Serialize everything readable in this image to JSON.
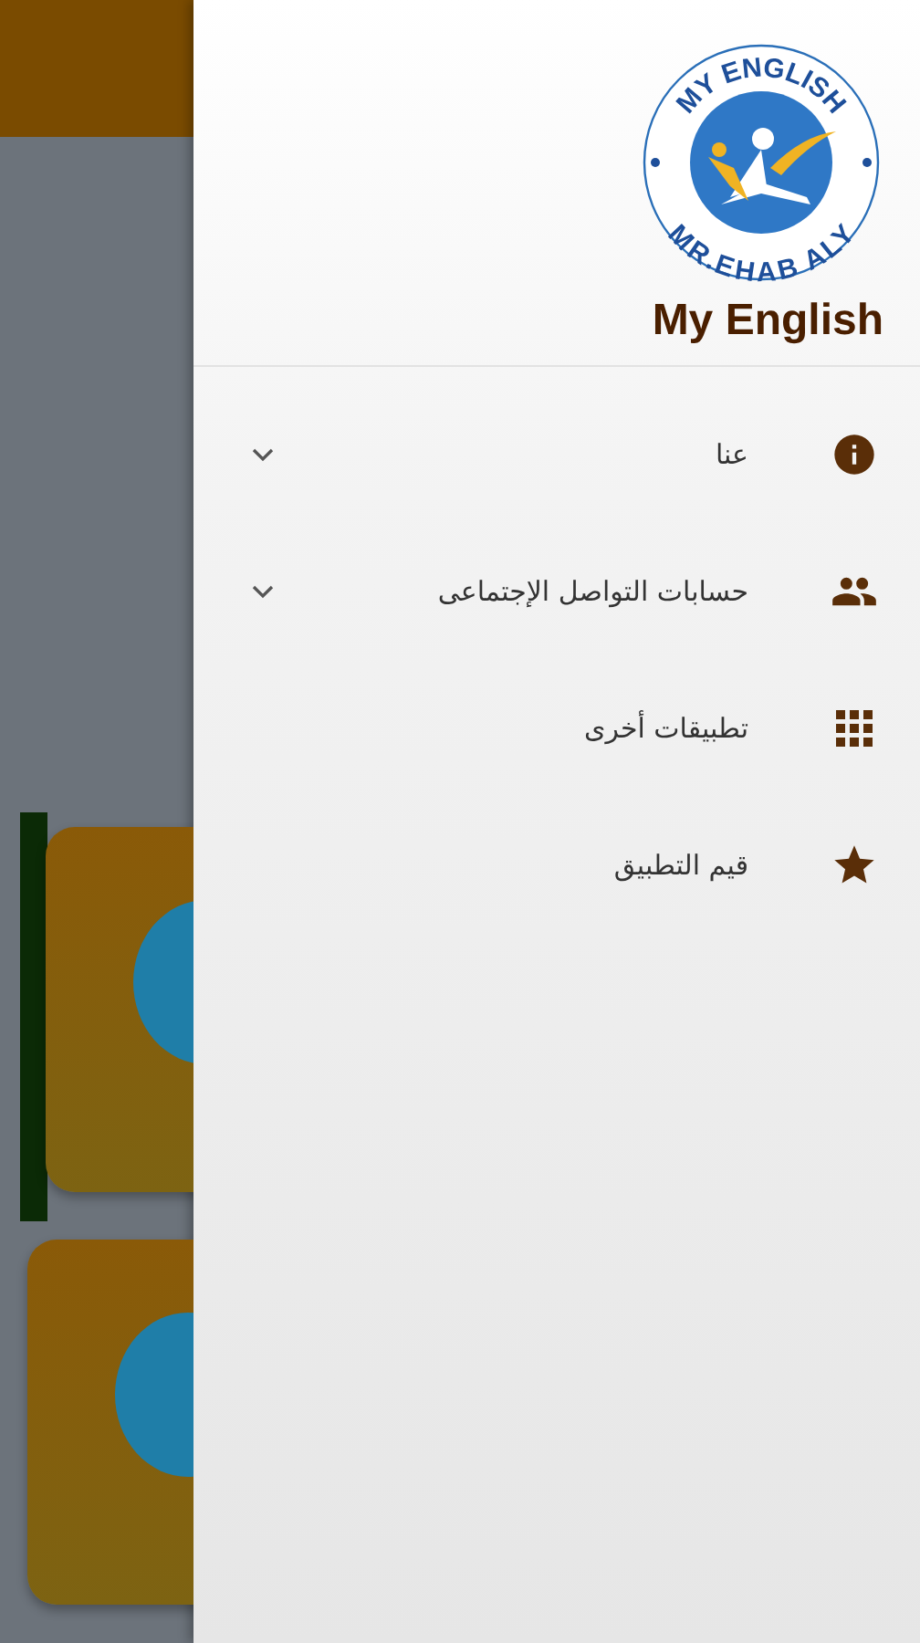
{
  "drawer": {
    "logo": {
      "top_text": "MY ENGLISH",
      "bottom_text": "MR.EHAB ALY"
    },
    "title": "My English",
    "items": [
      {
        "label": "عنا",
        "kind": "group",
        "expanded": false
      },
      {
        "label": "حسابات التواصل الإجتماعى",
        "kind": "group",
        "expanded": false
      },
      {
        "label": "تطبيقات أخرى",
        "kind": "link"
      },
      {
        "label": "قيم التطبيق",
        "kind": "link"
      }
    ]
  }
}
